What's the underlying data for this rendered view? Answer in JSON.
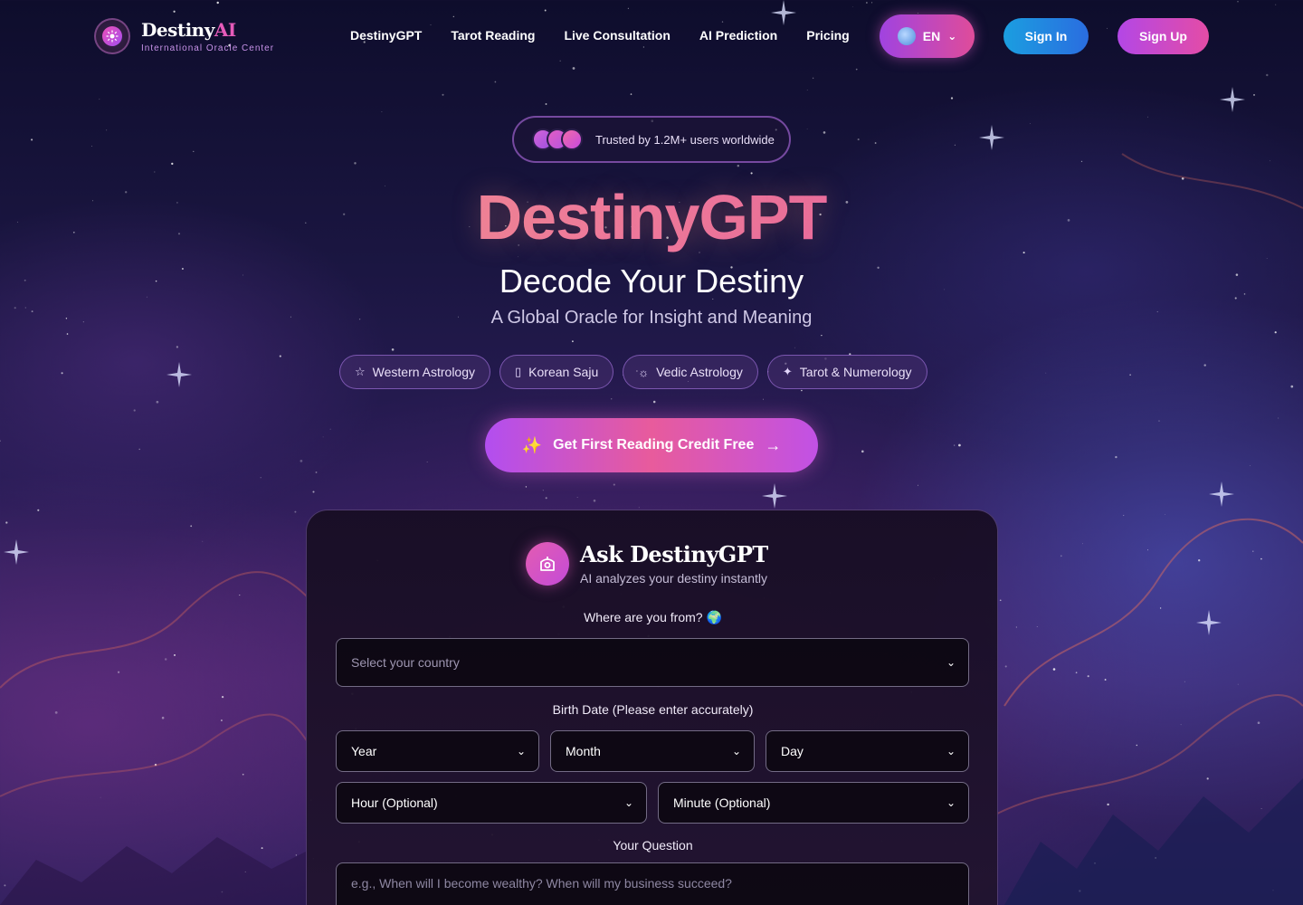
{
  "header": {
    "brand_main": "Destiny",
    "brand_accent": "AI",
    "brand_subtitle": "International Oracle Center",
    "nav": [
      "DestinyGPT",
      "Tarot Reading",
      "Live Consultation",
      "AI Prediction",
      "Pricing"
    ],
    "language": "EN",
    "signin_label": "Sign In",
    "signup_label": "Sign Up"
  },
  "hero": {
    "trusted_text": "Trusted by 1.2M+ users worldwide",
    "title": "DestinyGPT",
    "subtitle": "Decode Your Destiny",
    "tagline": "A Global Oracle for Insight and Meaning",
    "chips": [
      {
        "icon": "star-icon",
        "label": "Western Astrology"
      },
      {
        "icon": "book-icon",
        "label": "Korean Saju"
      },
      {
        "icon": "sun-icon",
        "label": "Vedic Astrology"
      },
      {
        "icon": "sparkle-icon",
        "label": "Tarot & Numerology"
      }
    ],
    "cta_label": "Get First Reading Credit Free"
  },
  "form": {
    "title": "Ask DestinyGPT",
    "subtitle": "AI analyzes your destiny instantly",
    "country_label": "Where are you from? 🌍",
    "country_placeholder": "Select your country",
    "birth_label": "Birth Date (Please enter accurately)",
    "year": "Year",
    "month": "Month",
    "day": "Day",
    "hour": "Hour (Optional)",
    "minute": "Minute (Optional)",
    "question_label": "Your Question",
    "question_placeholder": "e.g., When will I become wealthy? When will my business succeed?"
  },
  "colors": {
    "accent_pink": "#e55bb9",
    "accent_purple": "#b24ef0",
    "signin_blue": "#1b9ee0"
  }
}
